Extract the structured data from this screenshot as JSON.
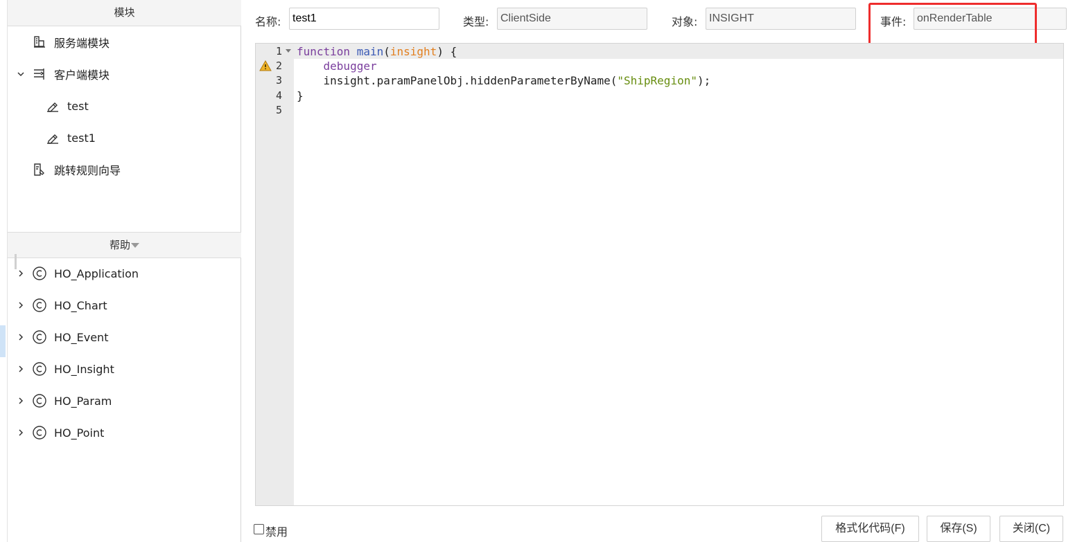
{
  "modules_panel": {
    "header": "模块",
    "items": [
      {
        "label": "服务端模块"
      },
      {
        "label": "客户端模块"
      },
      {
        "label": "test"
      },
      {
        "label": "test1"
      },
      {
        "label": "跳转规则向导"
      }
    ]
  },
  "help_panel": {
    "header": "帮助",
    "items": [
      {
        "label": "HO_Application"
      },
      {
        "label": "HO_Chart"
      },
      {
        "label": "HO_Event"
      },
      {
        "label": "HO_Insight"
      },
      {
        "label": "HO_Param"
      },
      {
        "label": "HO_Point"
      }
    ]
  },
  "form": {
    "name_label": "名称:",
    "name_value": "test1",
    "type_label": "类型:",
    "type_value": "ClientSide",
    "object_label": "对象:",
    "object_value": "INSIGHT",
    "event_label": "事件:",
    "event_value": "onRenderTable"
  },
  "editor": {
    "line_numbers": [
      "1",
      "2",
      "3",
      "4",
      "5"
    ],
    "code": {
      "l1_kw": "function",
      "l1_fn": "main",
      "l1_open": "(",
      "l1_param": "insight",
      "l1_close": ") {",
      "l2_dbg": "debugger",
      "l3_call": "insight.paramPanelObj.hiddenParameterByName(",
      "l3_str": "\"ShipRegion\"",
      "l3_end": ");",
      "l4": "}"
    }
  },
  "footer": {
    "disable_label": "禁用",
    "format_button": "格式化代码(F)",
    "save_button": "保存(S)",
    "close_button": "关闭(C)"
  },
  "colors": {
    "highlight_box": "#ee2d2d",
    "keyword": "#7a3e9d",
    "string": "#678d0f",
    "param": "#e27f1f"
  }
}
